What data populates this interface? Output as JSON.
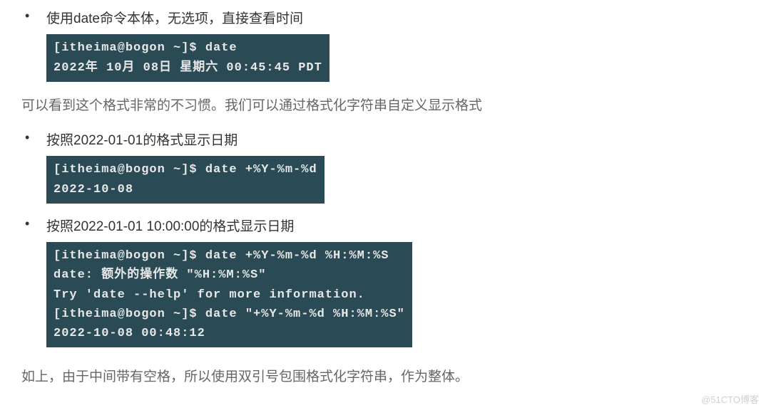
{
  "bullets": {
    "b1_text": "使用date命令本体，无选项，直接查看时间",
    "b1_term": {
      "l1": "[itheima@bogon ~]$ date",
      "l2": "2022年 10月 08日 星期六 00:45:45 PDT"
    },
    "b2_text": "按照2022-01-01的格式显示日期",
    "b2_term": {
      "l1": "[itheima@bogon ~]$ date +%Y-%m-%d",
      "l2": "2022-10-08"
    },
    "b3_text": "按照2022-01-01 10:00:00的格式显示日期",
    "b3_term": {
      "l1": "[itheima@bogon ~]$ date +%Y-%m-%d %H:%M:%S",
      "l2": "date: 额外的操作数 \"%H:%M:%S\"",
      "l3": "Try 'date --help' for more information.",
      "l4": "[itheima@bogon ~]$ date \"+%Y-%m-%d %H:%M:%S\"",
      "l5": "2022-10-08 00:48:12"
    }
  },
  "para1": "可以看到这个格式非常的不习惯。我们可以通过格式化字符串自定义显示格式",
  "para2": "如上，由于中间带有空格，所以使用双引号包围格式化字符串，作为整体。",
  "watermark": "@51CTO博客"
}
